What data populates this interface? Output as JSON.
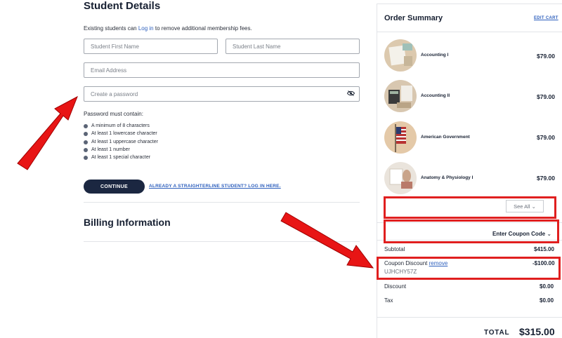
{
  "student_details": {
    "title": "Student Details",
    "existing_prefix": "Existing students can ",
    "existing_link": "Log in",
    "existing_suffix": " to remove additional membership fees.",
    "first_name_placeholder": "Student First Name",
    "last_name_placeholder": "Student Last Name",
    "email_placeholder": "Email Address",
    "password_placeholder": "Create a password",
    "password_rules_title": "Password must contain:",
    "password_rules": [
      "A minimum of 8 characters",
      "At least 1 lowercase character",
      "At least 1 uppercase character",
      "At least 1 number",
      "At least 1 special character"
    ],
    "continue_label": "CONTINUE",
    "login_link": "ALREADY A STRAIGHTERLINE STUDENT? LOG IN HERE."
  },
  "billing": {
    "title": "Billing Information"
  },
  "order_summary": {
    "title": "Order Summary",
    "edit_cart": "EDIT CART",
    "items": [
      {
        "name": "Accounting I",
        "price": "$79.00",
        "image": "accounting-notebook"
      },
      {
        "name": "Accounting II",
        "price": "$79.00",
        "image": "accounting-calculator"
      },
      {
        "name": "American Government",
        "price": "$79.00",
        "image": "us-flag"
      },
      {
        "name": "Anatomy & Physiology I",
        "price": "$79.00",
        "image": "anatomy-model"
      }
    ],
    "see_all": "See All",
    "coupon_toggle": "Enter Coupon Code",
    "subtotal_label": "Subtotal",
    "subtotal_value": "$415.00",
    "coupon_discount_label": "Coupon Discount",
    "coupon_remove": "remove",
    "coupon_discount_value": "-$100.00",
    "coupon_code": "UJHCHY57Z",
    "discount_label": "Discount",
    "discount_value": "$0.00",
    "tax_label": "Tax",
    "tax_value": "$0.00",
    "total_label": "TOTAL",
    "total_value": "$315.00"
  },
  "colors": {
    "navy": "#1b2741",
    "link_blue": "#2d5fbd",
    "highlight_red": "#e01f1f",
    "bullet_grey": "#5b6476"
  }
}
